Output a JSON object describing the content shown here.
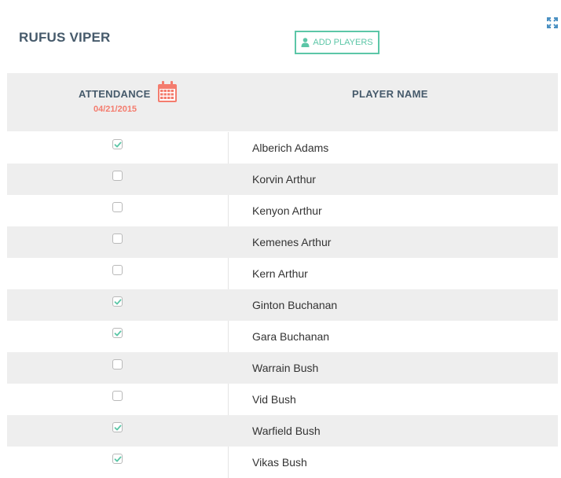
{
  "header": {
    "team_name": "RUFUS VIPER",
    "add_players_label": "ADD PLAYERS"
  },
  "table": {
    "attendance_label": "ATTENDANCE",
    "date": "04/21/2015",
    "player_name_label": "PLAYER NAME",
    "rows": [
      {
        "name": "Alberich Adams",
        "present": true
      },
      {
        "name": "Korvin Arthur",
        "present": false
      },
      {
        "name": "Kenyon Arthur",
        "present": false
      },
      {
        "name": "Kemenes Arthur",
        "present": false
      },
      {
        "name": "Kern Arthur",
        "present": false
      },
      {
        "name": "Ginton Buchanan",
        "present": true
      },
      {
        "name": "Gara Buchanan",
        "present": true
      },
      {
        "name": "Warrain Bush",
        "present": false
      },
      {
        "name": "Vid Bush",
        "present": false
      },
      {
        "name": "Warfield Bush",
        "present": true
      },
      {
        "name": "Vikas Bush",
        "present": true
      }
    ]
  },
  "icons": {
    "expand": "expand-icon",
    "add_user": "user-icon",
    "calendar": "calendar-icon",
    "check": "checkmark-icon"
  },
  "colors": {
    "accent_green": "#5cc6a7",
    "accent_coral": "#f47c6e",
    "heading_slate": "#465a6b",
    "row_alt_gray": "#eeeeee"
  }
}
